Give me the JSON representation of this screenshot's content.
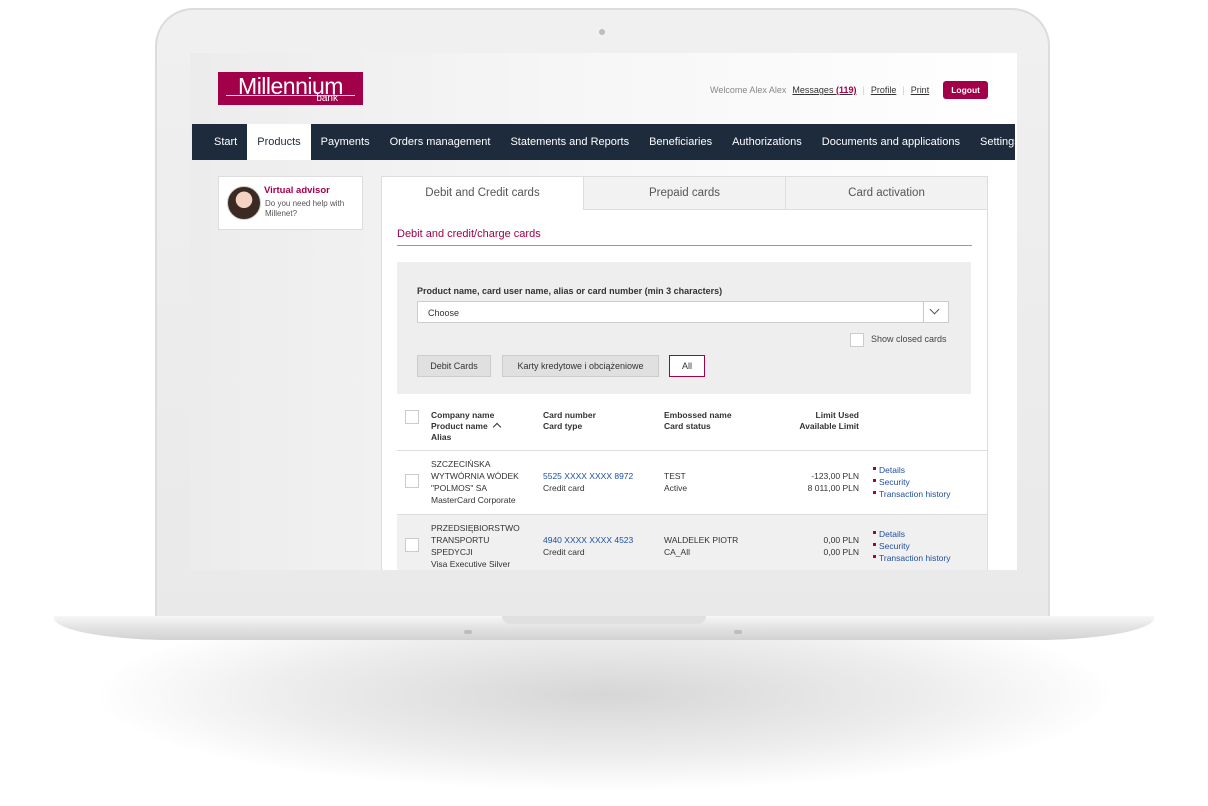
{
  "header": {
    "logo_text": "Millennium",
    "logo_sub": "bank",
    "welcome": "Welcome Alex Alex",
    "messages_label": "Messages",
    "messages_count": "(119)",
    "profile": "Profile",
    "print": "Print",
    "logout": "Logout"
  },
  "nav": {
    "items": [
      "Start",
      "Products",
      "Payments",
      "Orders management",
      "Statements and Reports",
      "Beneficiaries",
      "Authorizations",
      "Documents and applications",
      "Settings"
    ],
    "active": "Products"
  },
  "advisor": {
    "title": "Virtual advisor",
    "text": "Do you need help with Millenet?"
  },
  "tabs": [
    "Debit and Credit cards",
    "Prepaid cards",
    "Card activation"
  ],
  "section_title": "Debit and credit/charge cards",
  "filter": {
    "label": "Product name, card user name, alias or card number (min 3 characters)",
    "select_value": "Choose",
    "show_closed": "Show closed cards",
    "buttons": [
      "Debit Cards",
      "Karty kredytowe i obciążeniowe",
      "All"
    ],
    "selected_button": "All"
  },
  "table": {
    "headers": {
      "col1": [
        "Company name",
        "Product name",
        "Alias"
      ],
      "col2": [
        "Card number",
        "Card type"
      ],
      "col3": [
        "Embossed name",
        "Card status"
      ],
      "col4": [
        "Limit Used",
        "Available Limit"
      ]
    },
    "rows": [
      {
        "company": [
          "SZCZECIŃSKA",
          "WYTWÓRNIA WÓDEK",
          "\"POLMOS\" SA"
        ],
        "product": "MasterCard Corporate",
        "card_number": "5525 XXXX XXXX 8972",
        "card_type": "Credit card",
        "embossed": "TEST",
        "status": "Active",
        "limit_used": "-123,00 PLN",
        "available": "8 011,00 PLN",
        "links": [
          "Details",
          "Security",
          "Transaction history"
        ]
      },
      {
        "company": [
          "PRZEDSIĘBIORSTWO",
          "TRANSPORTU",
          "SPEDYCJI"
        ],
        "product": "Visa Executive Silver",
        "card_number": "4940 XXXX XXXX 4523",
        "card_type": "Credit card",
        "embossed": "WALDELEK PIOTR",
        "status": "CA_All",
        "limit_used": "0,00 PLN",
        "available": "0,00 PLN",
        "links": [
          "Details",
          "Security",
          "Transaction history"
        ]
      }
    ]
  },
  "colors": {
    "brand": "#a3004a",
    "nav_bg": "#1d2b3c",
    "link": "#1f4fa0"
  }
}
